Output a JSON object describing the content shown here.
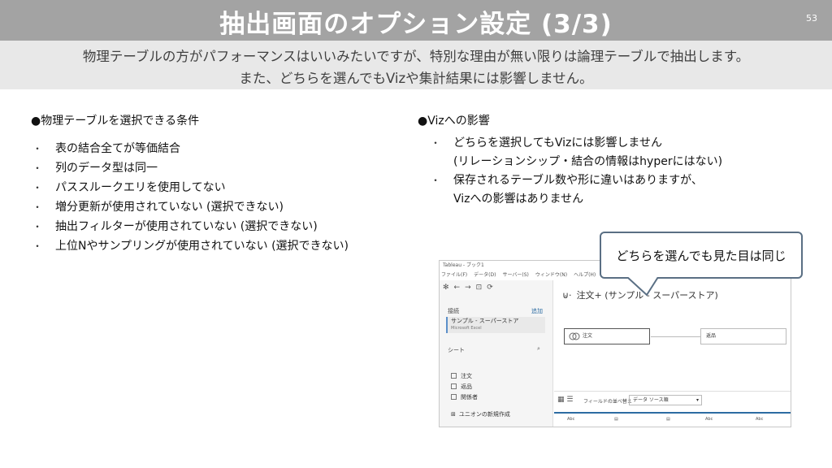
{
  "slide": {
    "title": "抽出画面のオプション設定 (3/3)",
    "page_number": "53",
    "subtitle_lines": [
      "物理テーブルの方がパフォーマンスはいいみたいですが、特別な理由が無い限りは論理テーブルで抽出します。",
      "また、どちらを選んでもVizや集計結果には影響しません。"
    ]
  },
  "conditions": {
    "heading": "●物理テーブルを選択できる条件",
    "bullet": "・",
    "items": [
      "表の結合全てが等価結合",
      "列のデータ型は同一",
      "パススルークエリを使用してない",
      "増分更新が使用されていない (選択できない)",
      "抽出フィルターが使用されていない (選択できない)",
      "上位Nやサンプリングが使用されていない (選択できない)"
    ]
  },
  "viz_impact": {
    "heading": "●Vizへの影響",
    "bullet": "・",
    "items": [
      {
        "line1": "どちらを選択してもVizには影響しません",
        "line2": "(リレーションシップ・結合の情報はhyperにはない)"
      },
      {
        "line1": "保存されるテーブル数や形に違いはありますが、",
        "line2": "Vizへの影響はありません"
      }
    ]
  },
  "callout": {
    "text": "どちらを選んでも見た目は同じ"
  },
  "screenshot": {
    "window_title": "Tableau - ブック1",
    "menu": [
      "ファイル(F)",
      "データ(D)",
      "サーバー(S)",
      "ウィンドウ(N)",
      "ヘルプ(H)"
    ],
    "toolbar_icons": [
      "✻",
      "←",
      "→",
      "⊡",
      "⟳"
    ],
    "connections_label": "接続",
    "connections_add": "追加",
    "connection_name": "サンプル - スーパーストア",
    "connection_type": "Microsoft Excel",
    "sheets_label": "シート",
    "sheets": [
      "注文",
      "返品",
      "関係者"
    ],
    "new_union": "ユニオンの新規作成",
    "datasource_title": "注文+ (サンプル - スーパーストア)",
    "tables": [
      "注文",
      "返品"
    ],
    "sort_label": "フィールドの並べ替え",
    "sort_value": "データ ソース順",
    "column_types": [
      "Abc",
      "▤",
      "▤",
      "Abc",
      "Abc"
    ]
  },
  "colors": {
    "title_bar": "#a3a3a3",
    "subtitle_bar": "#e8e8e8",
    "callout_border": "#5a6f84",
    "tableau_blue": "#2d6ca2"
  }
}
